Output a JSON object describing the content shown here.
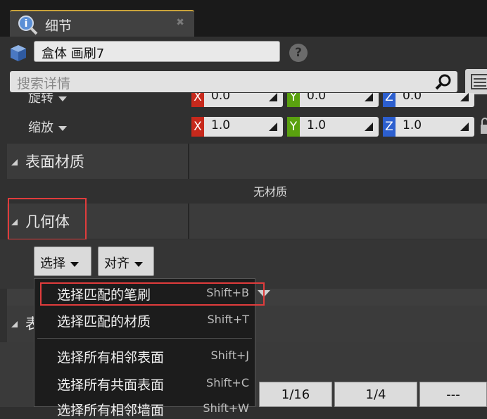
{
  "tab": {
    "title": "细节"
  },
  "header": {
    "name_value": "盒体 画刷7",
    "help_glyph": "?"
  },
  "search": {
    "placeholder": "搜索详情"
  },
  "transform": {
    "rotation": {
      "label": "旋转",
      "x": "0.0",
      "y": "0.0",
      "z": "0.0"
    },
    "scale": {
      "label": "缩放",
      "x": "1.0",
      "y": "1.0",
      "z": "1.0"
    },
    "axis_labels": {
      "x": "X",
      "y": "Y",
      "z": "Z"
    }
  },
  "surface_material": {
    "title": "表面材质",
    "empty_text": "无材质"
  },
  "geometry": {
    "title": "几何体",
    "select_button": "选择",
    "align_button": "对齐"
  },
  "hidden_section_title": "表",
  "menu": {
    "items": [
      {
        "label": "选择匹配的笔刷",
        "shortcut": "Shift+B"
      },
      {
        "label": "选择匹配的材质",
        "shortcut": "Shift+T"
      },
      {
        "label": "选择所有相邻表面",
        "shortcut": "Shift+J"
      },
      {
        "label": "选择所有共面表面",
        "shortcut": "Shift+C"
      },
      {
        "label": "选择所有相邻墙面",
        "shortcut": "Shift+W"
      }
    ]
  },
  "grid_buttons": [
    "1/16",
    "1/4",
    "---"
  ],
  "colors": {
    "axis_x": "#c7291c",
    "axis_y": "#5aa10f",
    "axis_z": "#2c5fcf",
    "highlight": "#e03c3c",
    "tab_accent": "#c9a23a"
  }
}
